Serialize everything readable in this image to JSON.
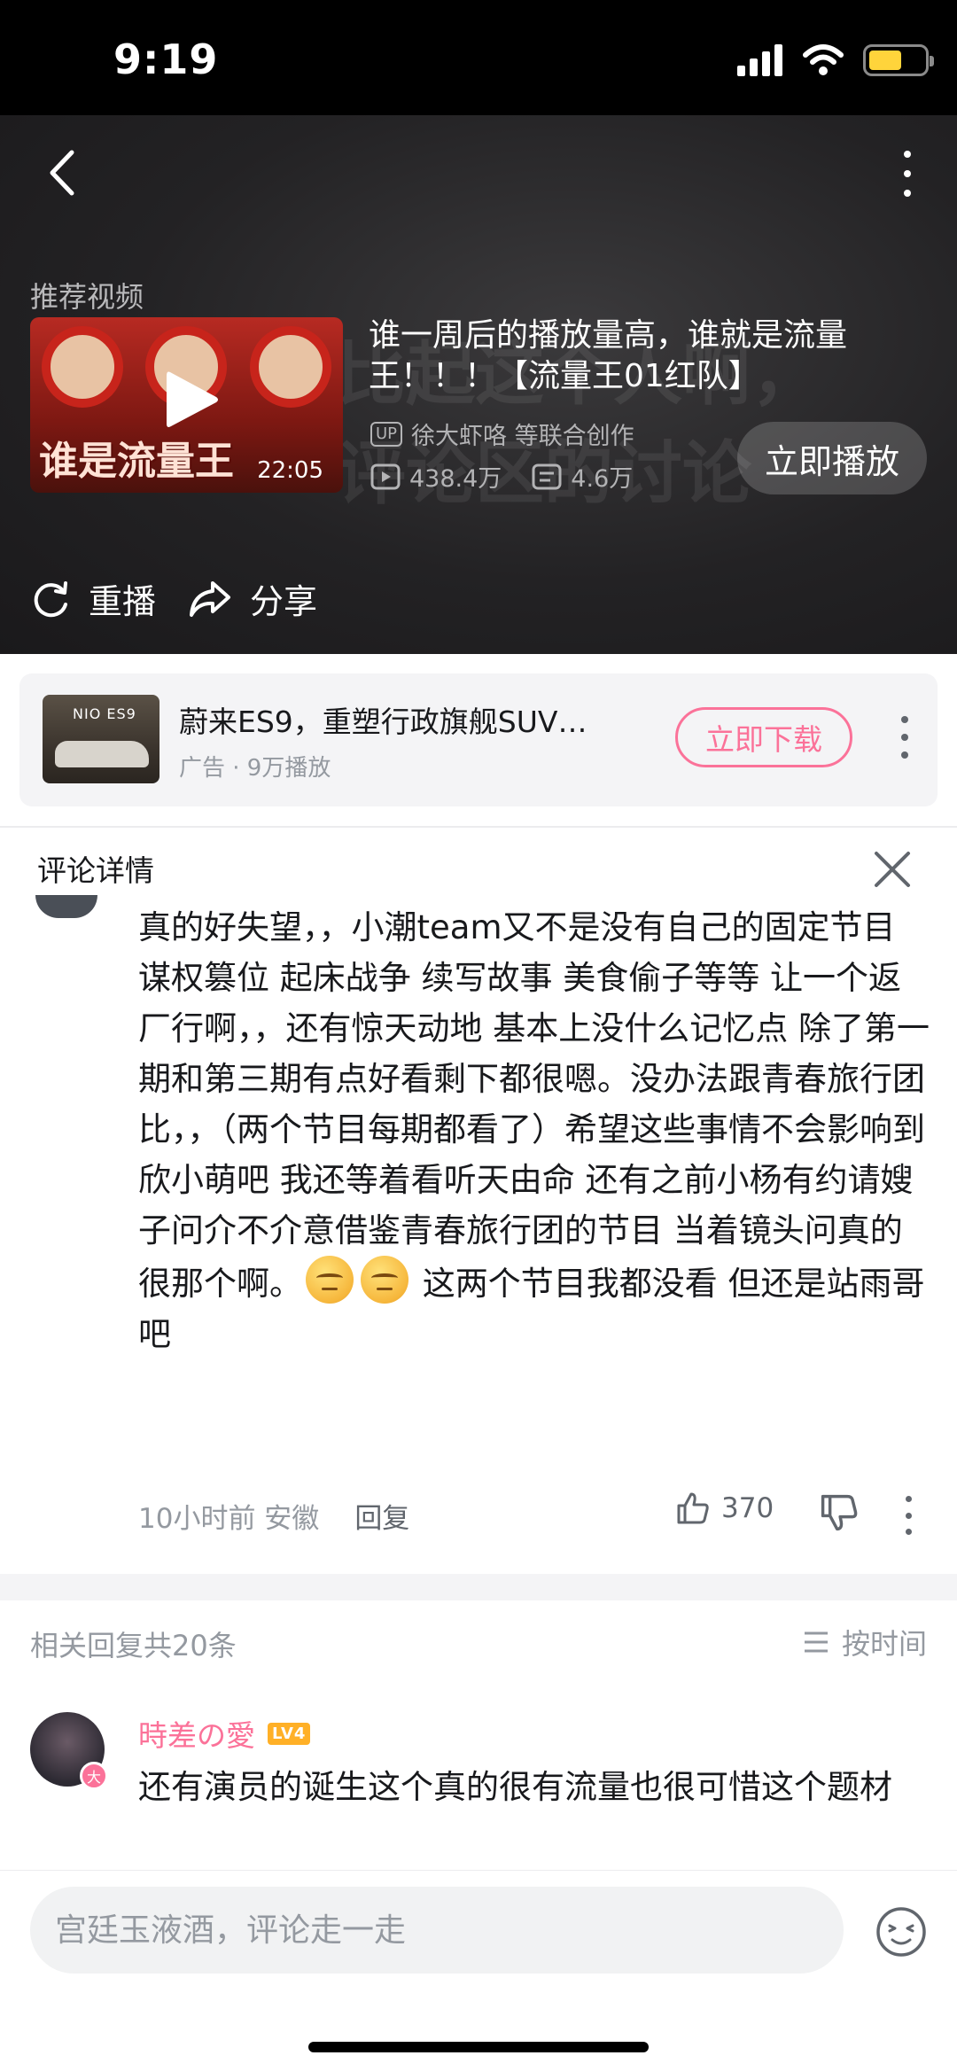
{
  "status_bar": {
    "time": "9:19",
    "battery_level": 0.6,
    "battery_color": "#ffd43b"
  },
  "video": {
    "recommend_label": "推荐视频",
    "thumb_title": "谁是流量王",
    "duration": "22:05",
    "title": "谁一周后的播放量高，谁就是流量王！！！【流量王01红队】",
    "up_tag": "UP",
    "author": "徐大虾咯 等联合创作",
    "views": "438.4万",
    "danmaku": "4.6万",
    "play_now": "立即播放",
    "replay": "重播",
    "share": "分享"
  },
  "ad": {
    "thumb_brand": "NIO ES9",
    "title": "蔚来ES9，重塑行政旗舰SUV…",
    "meta": "广告 · 9万播放",
    "download": "立即下载"
  },
  "comment_detail": {
    "title": "评论详情",
    "text_part1": "真的好失望，，小潮team又不是没有自己的固定节目 谋权篡位 起床战争 续写故事 美食偷子等等 让一个返厂行啊，，还有惊天动地 基本上没什么记忆点 除了第一期和第三期有点好看剩下都很嗯。没办法跟青春旅行团比，，（两个节目每期都看了）希望这些事情不会影响到欣小萌吧 我还等着看听天由命 还有之前小杨有约请嫂子问介不介意借鉴青春旅行团的节目 当着镜头问真的很那个啊。",
    "text_part2": " 这两个节目我都没看 但还是站雨哥吧",
    "time_location": "10小时前 安徽",
    "reply_label": "回复",
    "likes": "370"
  },
  "replies": {
    "count_label": "相关回复共20条",
    "sort_label": "按时间",
    "items": [
      {
        "user": "時差の愛",
        "level": "LV4",
        "badge": "大",
        "text": "还有演员的诞生这个真的很有流量也很可惜这个题材"
      }
    ]
  },
  "input": {
    "placeholder": "宫廷玉液酒，评论走一走"
  },
  "colors": {
    "accent_pink": "#fb7299",
    "level_orange": "#ffb027",
    "text_gray": "#9499a0"
  }
}
